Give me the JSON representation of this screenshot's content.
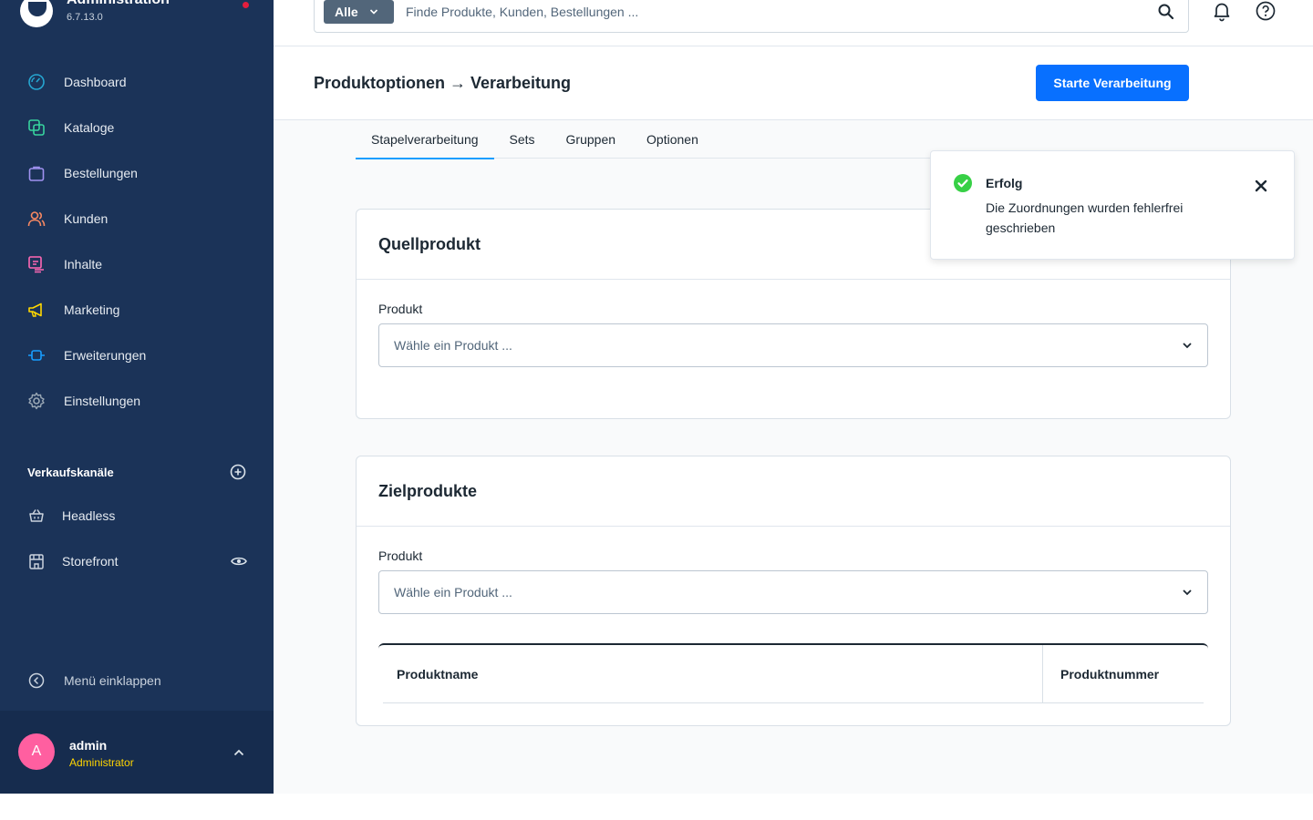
{
  "app": {
    "title": "Administration",
    "version": "6.7.13.0"
  },
  "nav": {
    "items": [
      {
        "label": "Dashboard",
        "icon": "dashboard-icon",
        "color": "#26a6d1"
      },
      {
        "label": "Kataloge",
        "icon": "catalog-icon",
        "color": "#37d39e"
      },
      {
        "label": "Bestellungen",
        "icon": "orders-icon",
        "color": "#a092f0"
      },
      {
        "label": "Kunden",
        "icon": "customers-icon",
        "color": "#f88962"
      },
      {
        "label": "Inhalte",
        "icon": "content-icon",
        "color": "#ff68b4"
      },
      {
        "label": "Marketing",
        "icon": "marketing-icon",
        "color": "#ffd700"
      },
      {
        "label": "Erweiterungen",
        "icon": "extensions-icon",
        "color": "#189eff"
      },
      {
        "label": "Einstellungen",
        "icon": "settings-icon",
        "color": "#9aa8b5"
      }
    ]
  },
  "sales_channels": {
    "title": "Verkaufskanäle",
    "items": [
      {
        "label": "Headless"
      },
      {
        "label": "Storefront"
      }
    ]
  },
  "sidebar": {
    "collapse_label": "Menü einklappen"
  },
  "user": {
    "initial": "A",
    "name": "admin",
    "role": "Administrator"
  },
  "search": {
    "type_label": "Alle",
    "placeholder": "Finde Produkte, Kunden, Bestellungen ..."
  },
  "page": {
    "title": "Produktoptionen → Verarbeitung",
    "primary_action": "Starte Verarbeitung"
  },
  "tabs": [
    {
      "label": "Stapelverarbeitung",
      "active": true
    },
    {
      "label": "Sets",
      "active": false
    },
    {
      "label": "Gruppen",
      "active": false
    },
    {
      "label": "Optionen",
      "active": false
    }
  ],
  "source_card": {
    "title": "Quellprodukt",
    "field_label": "Produkt",
    "select_placeholder": "Wähle ein Produkt ..."
  },
  "target_card": {
    "title": "Zielprodukte",
    "field_label": "Produkt",
    "select_placeholder": "Wähle ein Produkt ...",
    "columns": [
      "Produktname",
      "Produktnummer"
    ]
  },
  "notification": {
    "title": "Erfolg",
    "message": "Die Zuordnungen wurden fehlerfrei geschrieben",
    "status_color": "#37d046"
  },
  "colors": {
    "sidebar_bg": "#1b3358",
    "primary": "#0870ff",
    "tab_active": "#189eff",
    "role_text": "#ffd500",
    "avatar": "#ff5fa0"
  }
}
